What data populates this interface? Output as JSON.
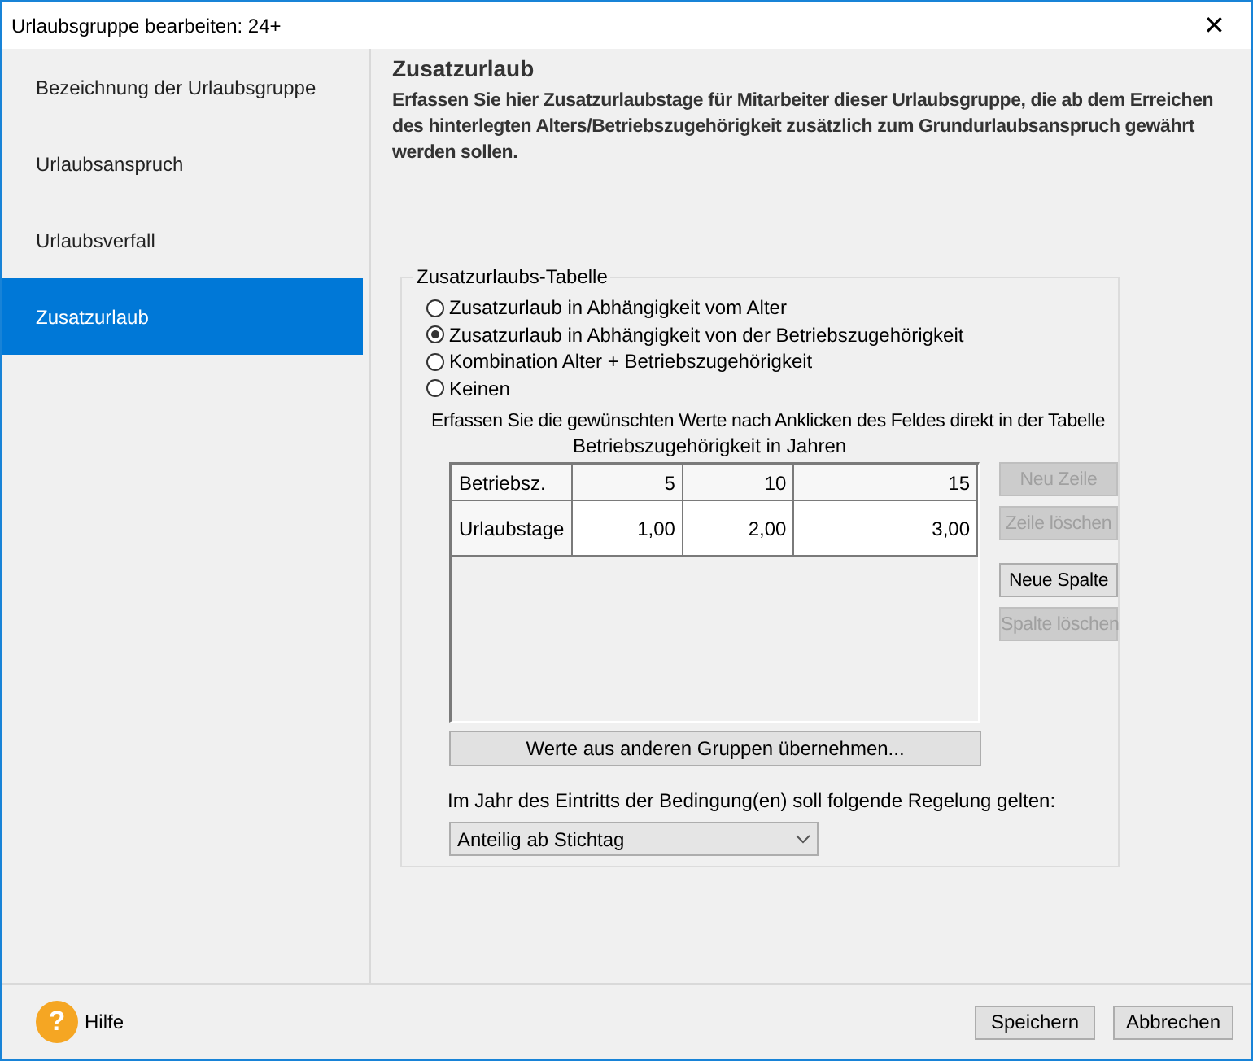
{
  "window": {
    "title": "Urlaubsgruppe bearbeiten: 24+",
    "close": "✕"
  },
  "sidebar": {
    "items": [
      {
        "label": "Bezeichnung der Urlaubsgruppe",
        "selected": false
      },
      {
        "label": "Urlaubsanspruch",
        "selected": false
      },
      {
        "label": "Urlaubsverfall",
        "selected": false
      },
      {
        "label": "Zusatzurlaub",
        "selected": true
      }
    ]
  },
  "section": {
    "title": "Zusatzurlaub",
    "description": "Erfassen Sie hier Zusatzurlaubstage für Mitarbeiter dieser Urlaubsgruppe, die ab dem Erreichen des hinterlegten Alters/Betriebszugehörigkeit zusätzlich zum Grundurlaubsanspruch gewährt werden sollen."
  },
  "group": {
    "title": "Zusatzurlaubs-Tabelle",
    "options": [
      {
        "label": "Zusatzurlaub in Abhängigkeit vom Alter",
        "selected": false
      },
      {
        "label": "Zusatzurlaub in Abhängigkeit von der Betriebszugehörigkeit",
        "selected": true
      },
      {
        "label": "Kombination Alter + Betriebszugehörigkeit",
        "selected": false
      },
      {
        "label": "Keinen",
        "selected": false
      }
    ],
    "hint": "Erfassen Sie die gewünschten Werte nach Anklicken des Feldes direkt in der Tabelle",
    "table": {
      "caption": "Betriebszugehörigkeit in Jahren",
      "rows": [
        [
          "Betriebsz.",
          "5",
          "10",
          "15"
        ],
        [
          "Urlaubstage",
          "1,00",
          "2,00",
          "3,00"
        ]
      ]
    },
    "side_buttons": [
      {
        "label": "Neu Zeile",
        "disabled": true
      },
      {
        "label": "Zeile löschen",
        "disabled": true
      },
      {
        "label": "Neue Spalte",
        "disabled": false
      },
      {
        "label": "Spalte löschen",
        "disabled": true
      }
    ],
    "import_button": "Werte aus anderen Gruppen übernehmen...",
    "rule_label": "Im Jahr des Eintritts der Bedingung(en) soll folgende Regelung gelten:",
    "rule_dropdown": {
      "value": "Anteilig ab Stichtag"
    }
  },
  "footer": {
    "help": {
      "icon": "?",
      "label": "Hilfe"
    },
    "buttons": [
      "Speichern",
      "Abbrechen"
    ]
  }
}
